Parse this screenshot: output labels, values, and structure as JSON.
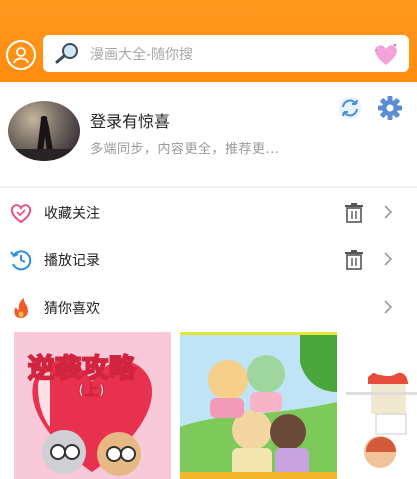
{
  "header": {
    "search_placeholder": "漫画大全-随你搜",
    "colors": {
      "accent": "#ff9417"
    }
  },
  "profile": {
    "title": "登录有惊喜",
    "subtitle": "多端同步，内容更全，推荐更..."
  },
  "menu": {
    "favorites": "收藏关注",
    "history": "播放记录",
    "recommend": "猜你喜欢"
  },
  "covers": [
    {
      "title": "逆袭攻略",
      "subtitle": "(上)"
    },
    {
      "title": "",
      "subtitle": ""
    },
    {
      "title": "",
      "subtitle": ""
    }
  ]
}
